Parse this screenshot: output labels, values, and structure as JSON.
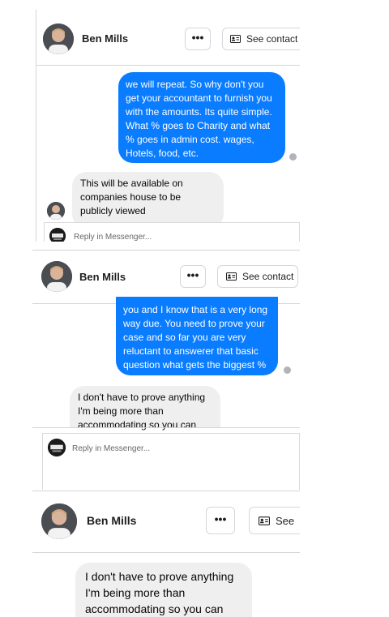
{
  "panel1": {
    "contact_name": "Ben Mills",
    "more_button_label": "•••",
    "see_contact_label": "See contact",
    "sent_message": "we will repeat. So why don't you get your accountant to furnish you with the amounts. Its quite simple. What % goes to Charity and what % goes in admin cost. wages, Hotels, food, etc.",
    "received_message": "This will be available on companies house to be publicly viewed",
    "reply_placeholder": "Reply in Messenger..."
  },
  "panel2": {
    "contact_name": "Ben Mills",
    "more_button_label": "•••",
    "see_contact_label": "See contact",
    "sent_message": "you and I know that is a very long way due. You need to prove your case and so far you are very reluctant to answerer that basic question what gets the biggest %",
    "received_message": "I don't have to prove anything I'm being more than accommodating so you can",
    "reply_placeholder": "Reply in Messenger..."
  },
  "panel3": {
    "contact_name": "Ben Mills",
    "more_button_label": "•••",
    "see_contact_label": "See",
    "received_message": "I don't have to prove anything I'm being more than accommodating so you can"
  },
  "colors": {
    "sent_bubble": "#0a7cff",
    "received_bubble": "#efefef",
    "muted_text": "#65676b"
  },
  "icons": {
    "more": "more-icon",
    "contact_card": "contact-card-icon",
    "seen": "seen-icon"
  }
}
